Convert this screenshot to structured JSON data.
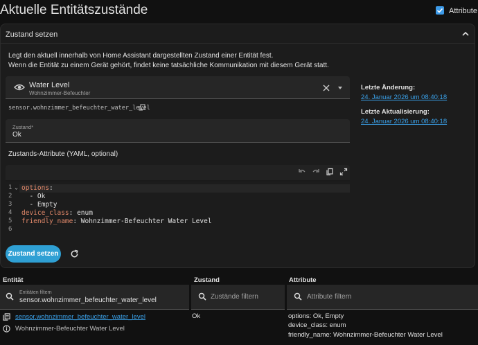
{
  "header": {
    "title": "Aktuelle Entitätszustände",
    "attributes_label": "Attribute",
    "attributes_checked": true
  },
  "card": {
    "title": "Zustand setzen",
    "description_line1": "Legt den aktuell innerhalb von Home Assistant dargestellten Zustand einer Entität fest.",
    "description_line2": "Wenn die Entität zu einem Gerät gehört, findet keine tatsächliche Kommunikation mit diesem Gerät statt.",
    "entity_picker": {
      "name": "Water Level",
      "device": "Wohnzimmer-Befeuchter"
    },
    "entity_id": "sensor.wohnzimmer_befeuchter_water_level",
    "state_field": {
      "label": "Zustand*",
      "value": "Ok"
    },
    "yaml_label": "Zustands-Attribute (YAML, optional)",
    "code_lines": [
      {
        "num": "1",
        "key": "options",
        "rest": ":"
      },
      {
        "num": "2",
        "key": "",
        "rest": "  - Ok"
      },
      {
        "num": "3",
        "key": "",
        "rest": "  - Empty"
      },
      {
        "num": "4",
        "key": "device_class",
        "rest": ": enum"
      },
      {
        "num": "5",
        "key": "friendly_name",
        "rest": ": Wohnzimmer-Befeuchter Water Level"
      },
      {
        "num": "6",
        "key": "",
        "rest": ""
      }
    ],
    "set_button": "Zustand setzen",
    "last_changed_label": "Letzte Änderung:",
    "last_changed_value": "24. Januar 2026 um 08:40:18",
    "last_updated_label": "Letzte Aktualisierung:",
    "last_updated_value": "24. Januar 2026 um 08:40:18"
  },
  "table": {
    "col_entity": "Entität",
    "col_state": "Zustand",
    "col_attributes": "Attribute",
    "entity_filter_label": "Entitäten filtern",
    "entity_filter_value": "sensor.wohnzimmer_befeuchter_water_level",
    "state_filter_placeholder": "Zustände filtern",
    "attribute_filter_placeholder": "Attribute filtern",
    "rows": [
      {
        "entity_id": "sensor.wohnzimmer_befeuchter_water_level",
        "friendly_name": "Wohnzimmer-Befeuchter Water Level",
        "state": "Ok",
        "attr1": "options: Ok, Empty",
        "attr2": "device_class: enum",
        "attr3": "friendly_name: Wohnzimmer-Befeuchter Water Level"
      }
    ]
  },
  "colors": {
    "accent": "#3d9be9",
    "button": "#2fa0d4",
    "link": "#3aa0e8",
    "yaml_key": "#e48a6b"
  }
}
